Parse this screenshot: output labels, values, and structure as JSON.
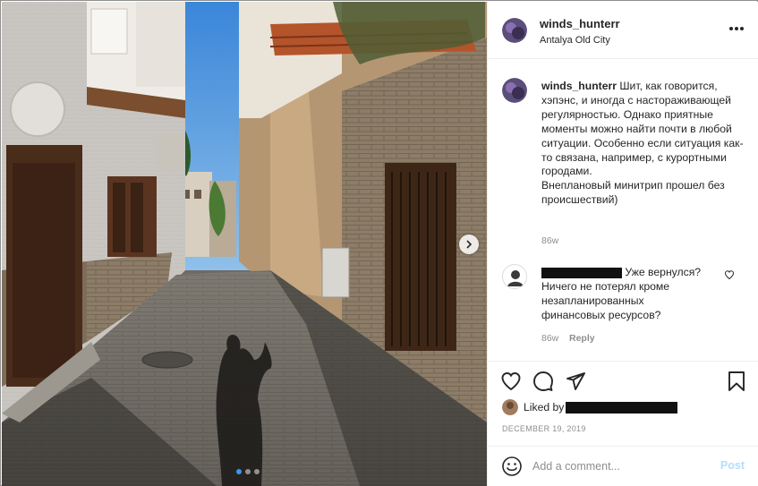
{
  "post": {
    "username": "winds_hunterr",
    "location": "Antalya Old City",
    "photo_alt": "Old town street with shadow of a person",
    "carousel_dots": 3,
    "active_dot": 1
  },
  "caption": {
    "username": "winds_hunterr",
    "text": "Шит, как говорится, хэпэнс, и иногда с настораживающей регулярностью. Однако приятные моменты можно найти почти в любой ситуации. Особенно если ситуация как-то связана, например, с курортными городами.\nВнеплановый минитрип прошел без происшествий)",
    "time": "86w"
  },
  "comment": {
    "text_head": "Уже вернулся?",
    "text_tail": "Ничего не потерял кроме незапланированных финансовых ресурсов?",
    "time": "86w",
    "reply_label": "Reply"
  },
  "likes": {
    "prefix": "Liked by"
  },
  "date": "DECEMBER 19, 2019",
  "add_comment": {
    "placeholder": "Add a comment...",
    "post_label": "Post"
  },
  "colors": {
    "accent_blue": "#3897f0",
    "post_disabled": "#b2dffc",
    "muted_text": "#8e8e8e"
  }
}
